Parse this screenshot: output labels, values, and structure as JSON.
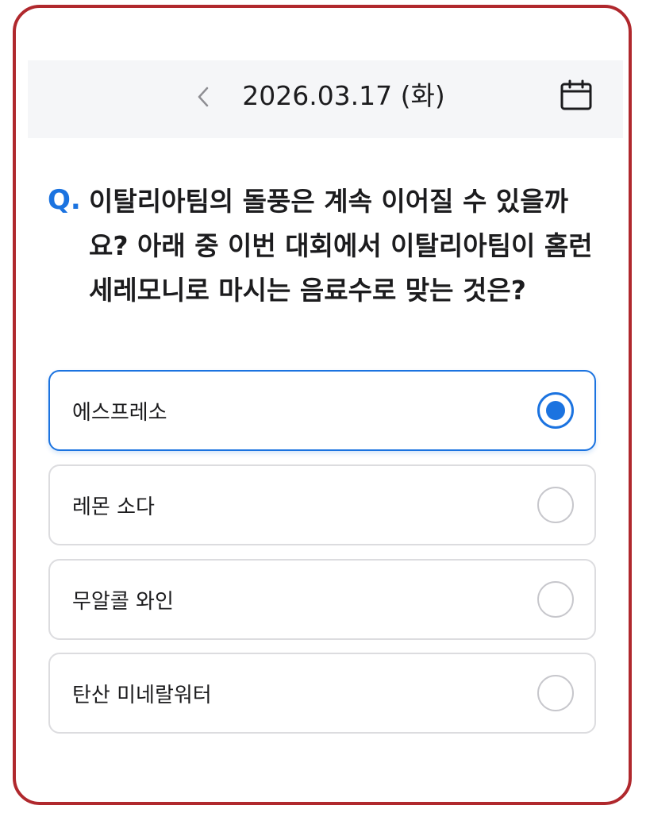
{
  "header": {
    "date": "2026.03.17 (화)",
    "prev_icon": "chevron-left-icon",
    "calendar_icon": "calendar-icon"
  },
  "quiz": {
    "question_mark": "Q.",
    "question": "이탈리아팀의 돌풍은 계속 이어질 수 있을까요? 아래 중 이번 대회에서 이탈리아팀이 홈런 세레모니로 마시는 음료수로 맞는 것은?",
    "options": [
      {
        "label": "에스프레소",
        "selected": true
      },
      {
        "label": "레몬 소다",
        "selected": false
      },
      {
        "label": "무알콜 와인",
        "selected": false
      },
      {
        "label": "탄산 미네랄워터",
        "selected": false
      }
    ]
  },
  "colors": {
    "accent": "#1b73e0",
    "frame": "#b0282d",
    "header_bg": "#f5f6f8",
    "option_border": "#dcdcdf"
  }
}
